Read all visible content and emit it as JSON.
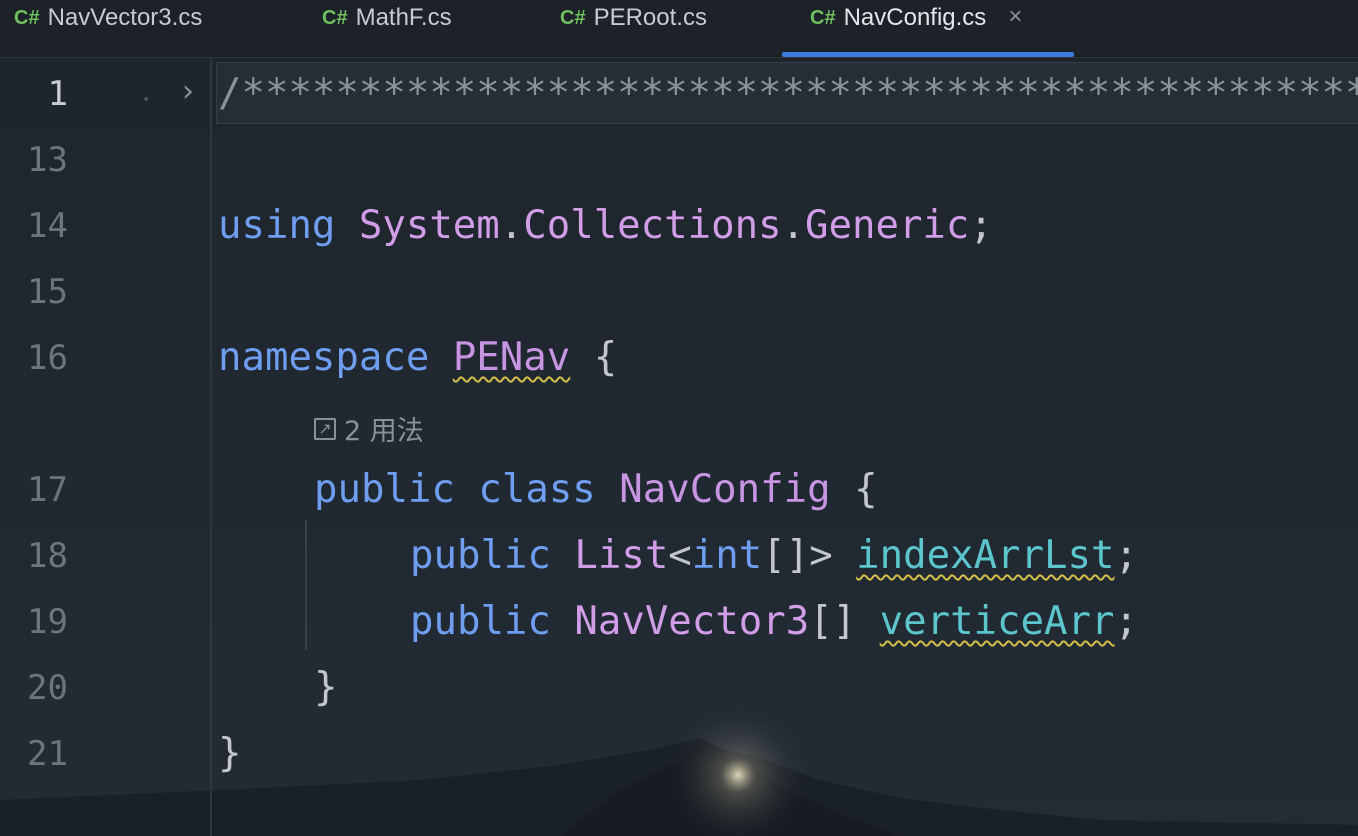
{
  "tabs": [
    {
      "lang": "C#",
      "name": "NavVector3.cs",
      "active": false
    },
    {
      "lang": "C#",
      "name": "MathF.cs",
      "active": false
    },
    {
      "lang": "C#",
      "name": "PERoot.cs",
      "active": false
    },
    {
      "lang": "C#",
      "name": "NavConfig.cs",
      "active": true
    }
  ],
  "tab_close": "×",
  "accent_color": "#3d7ddd",
  "line_numbers": [
    "1",
    "13",
    "14",
    "15",
    "16",
    "17",
    "18",
    "19",
    "20",
    "21"
  ],
  "folded_comment": "/*****************************************************",
  "code": {
    "l14": {
      "kw": "using",
      "ns1": "System",
      "dot1": ".",
      "ns2": "Collections",
      "dot2": ".",
      "ns3": "Generic",
      "end": ";"
    },
    "l16": {
      "kw": "namespace",
      "name": "PENav",
      "brace": "{"
    },
    "usage": {
      "icon": "↗",
      "text": "2 用法"
    },
    "l17": {
      "kw1": "public",
      "kw2": "class",
      "name": "NavConfig",
      "brace": "{"
    },
    "l18": {
      "kw": "public",
      "type": "List",
      "lt": "<",
      "kw2": "int",
      "arr": "[]",
      "gt": ">",
      "field": "indexArrLst",
      "end": ";"
    },
    "l19": {
      "kw": "public",
      "type": "NavVector3",
      "arr": "[]",
      "field": "verticeArr",
      "end": ";"
    },
    "l20": {
      "brace": "}"
    },
    "l21": {
      "brace": "}"
    }
  }
}
